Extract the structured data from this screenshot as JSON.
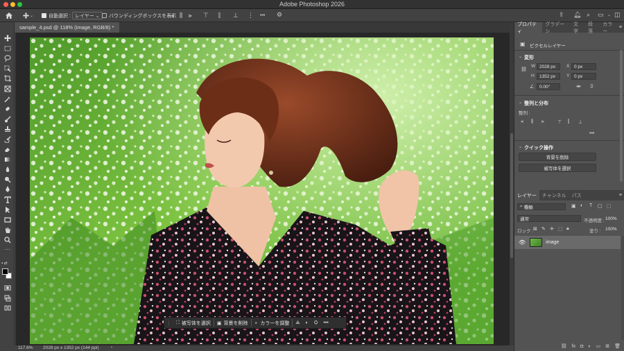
{
  "window": {
    "title": "Adobe Photoshop 2026"
  },
  "options_bar": {
    "auto_select_label": "自動選択 :",
    "auto_select_target": "レイヤー",
    "bounding_box_label": "バウンディングボックスを表示",
    "more": "•••"
  },
  "document": {
    "tab_title": "sample_4.psd @ 118% (image, RGB/8) *",
    "close_glyph": "×"
  },
  "contextual_taskbar": {
    "select_subject": "被写体を選択",
    "remove_background": "背景を削除",
    "color_adjust": "カラーを調整",
    "more": "•••"
  },
  "status_bar": {
    "zoom": "117.6%",
    "doc_info": "2028 px x 1352 px (144 ppi)"
  },
  "properties_panel": {
    "tabs": [
      "プロパティ",
      "グラデーシ",
      "文字",
      "段落",
      "カラー"
    ],
    "pixel_layer_label": "ピクセルレイヤー",
    "transform_header": "変形",
    "w_label": "W",
    "w_value": "2028 px",
    "h_label": "H",
    "h_value": "1352 px",
    "x_label": "X",
    "x_value": "0 px",
    "y_label": "Y",
    "y_value": "0 px",
    "angle_value": "0.00°",
    "align_header": "整列と分布",
    "align_label": "整列 :",
    "more": "•••",
    "quick_actions_header": "クイック操作",
    "remove_background_button": "背景を削除",
    "select_subject_button": "被写体を選択"
  },
  "layers_panel": {
    "tabs": [
      "レイヤー",
      "チャンネル",
      "パス"
    ],
    "filter_kind": "種類",
    "blend_mode": "通常",
    "opacity_label": "不透明度 :",
    "opacity_value": "100%",
    "lock_label": "ロック :",
    "fill_label": "塗り :",
    "fill_value": "100%",
    "layers": [
      {
        "name": "image",
        "visible": true
      }
    ]
  },
  "colors": {
    "app_bg": "#535353",
    "panel_dark": "#424242",
    "titlebar": "#323232",
    "close": "#ff5f57",
    "minimize": "#febc2e",
    "zoom": "#28c840"
  }
}
